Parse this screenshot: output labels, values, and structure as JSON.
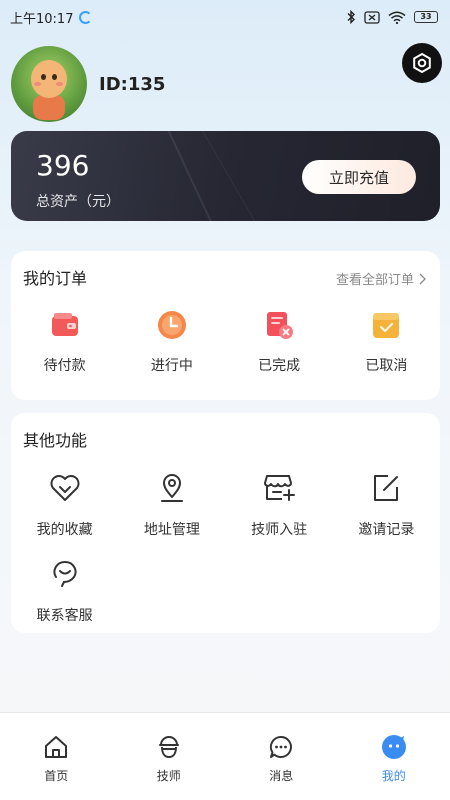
{
  "status_bar": {
    "time": "上午10:17",
    "battery": "33"
  },
  "profile": {
    "id_text": "ID:135"
  },
  "asset": {
    "amount": "396",
    "label": "总资产（元）",
    "recharge_label": "立即充值"
  },
  "orders": {
    "title": "我的订单",
    "view_all": "查看全部订单",
    "items": [
      {
        "label": "待付款",
        "icon": "wallet-icon",
        "color": "#f25a5a"
      },
      {
        "label": "进行中",
        "icon": "clock-icon",
        "color": "#f5874a"
      },
      {
        "label": "已完成",
        "icon": "document-done-icon",
        "color": "#f2515c"
      },
      {
        "label": "已取消",
        "icon": "cancelled-box-icon",
        "color": "#f5b23a"
      }
    ]
  },
  "functions": {
    "title": "其他功能",
    "items": [
      {
        "label": "我的收藏",
        "icon": "heart-icon"
      },
      {
        "label": "地址管理",
        "icon": "location-pin-icon"
      },
      {
        "label": "技师入驻",
        "icon": "storefront-icon"
      },
      {
        "label": "邀请记录",
        "icon": "edit-icon"
      },
      {
        "label": "联系客服",
        "icon": "headset-icon"
      }
    ]
  },
  "bottom_nav": {
    "items": [
      {
        "label": "首页",
        "icon": "home-icon"
      },
      {
        "label": "技师",
        "icon": "technician-icon"
      },
      {
        "label": "消息",
        "icon": "message-icon"
      },
      {
        "label": "我的",
        "icon": "profile-face-icon"
      }
    ],
    "active_index": 3,
    "active_color": "#3b8cf0"
  }
}
